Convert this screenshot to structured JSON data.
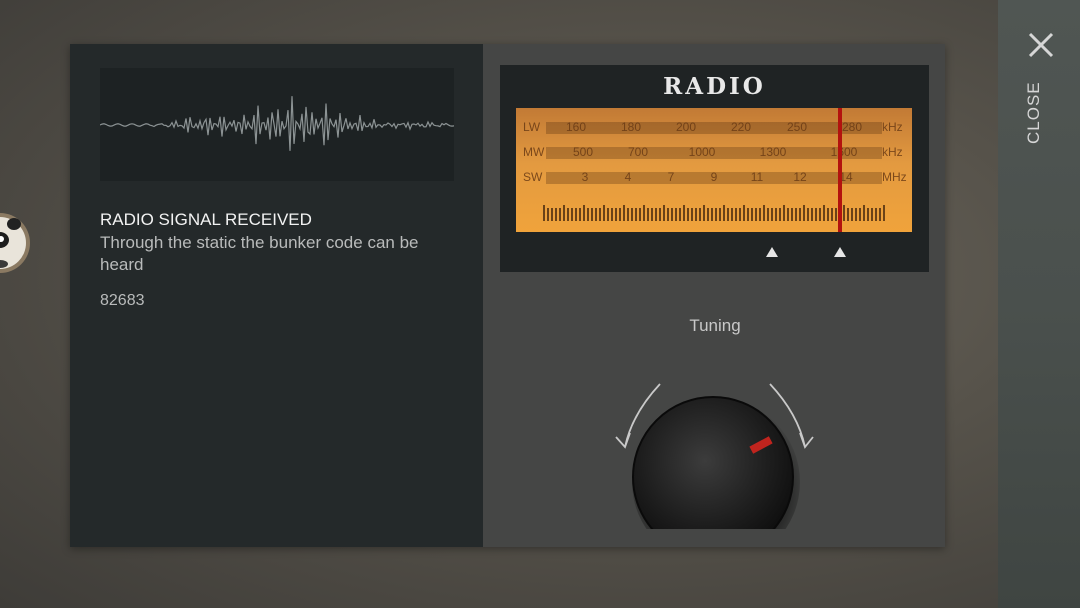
{
  "close": {
    "label": "CLOSE",
    "icon": "close-icon"
  },
  "message": {
    "title": "RADIO SIGNAL RECEIVED",
    "body": "Through the static the bunker code can be heard",
    "code": "82683"
  },
  "radio": {
    "title": "RADIO",
    "bands": [
      {
        "label": "LW",
        "unit": "kHz",
        "values": [
          "160",
          "180",
          "200",
          "220",
          "250",
          "280"
        ]
      },
      {
        "label": "MW",
        "unit": "kHz",
        "values": [
          "500",
          "700",
          "1000",
          "1300",
          "1600"
        ]
      },
      {
        "label": "SW",
        "unit": "MHz",
        "values": [
          "3",
          "4",
          "7",
          "9",
          "11",
          "12",
          "14"
        ]
      }
    ],
    "needle_color": "#b3120e"
  },
  "tuning": {
    "label": "Tuning",
    "knob_indicator_color": "#c0241e"
  },
  "colors": {
    "dial_amber": "#e39a40",
    "panel_dark": "#24292a"
  }
}
